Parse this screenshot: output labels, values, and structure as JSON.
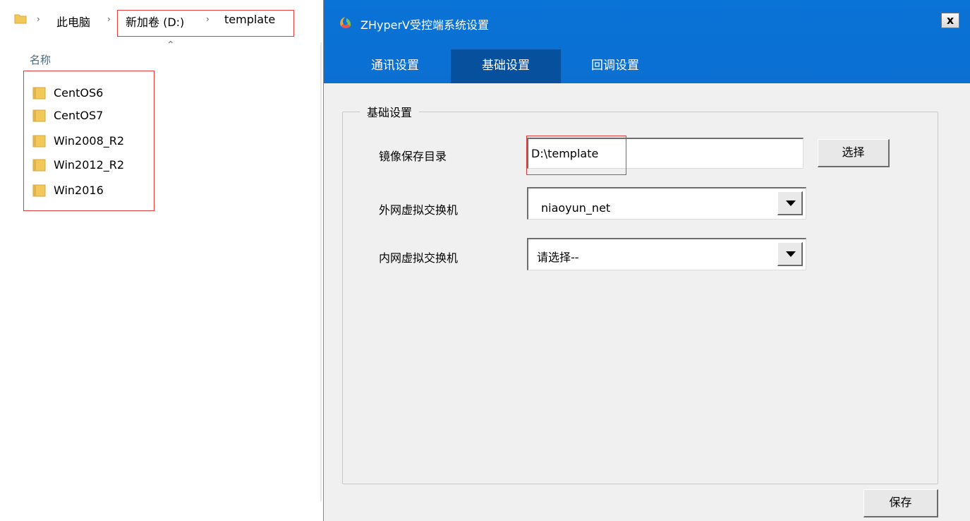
{
  "explorer": {
    "breadcrumb": [
      "此电脑",
      "新加卷 (D:)",
      "template"
    ],
    "column_header": "名称",
    "files": [
      "CentOS6",
      "CentOS7",
      "Win2008_R2",
      "Win2012_R2",
      "Win2016"
    ]
  },
  "dialog": {
    "title": "ZHyperV受控端系统设置",
    "close_glyph": "x",
    "tabs": [
      {
        "label": "通讯设置",
        "active": false
      },
      {
        "label": "基础设置",
        "active": true
      },
      {
        "label": "回调设置",
        "active": false
      }
    ],
    "group_title": "基础设置",
    "image_dir_label": "镜像保存目录",
    "image_dir_value": "D:\\template",
    "choose_label": "选择",
    "external_switch_label": "外网虚拟交换机",
    "external_switch_value": "niaoyun_net",
    "internal_switch_label": "内网虚拟交换机",
    "internal_switch_value": "请选择--",
    "save_label": "保存"
  },
  "colors": {
    "titlebar": "#0b6fd2",
    "active_tab": "#07509d",
    "highlight": "#e23b3b",
    "folder": "#f3c85a"
  },
  "icons": {
    "folder": "folder-icon",
    "app": "app-logo-icon",
    "dropdown": "chevron-down-icon",
    "sort": "sort-up-icon"
  }
}
